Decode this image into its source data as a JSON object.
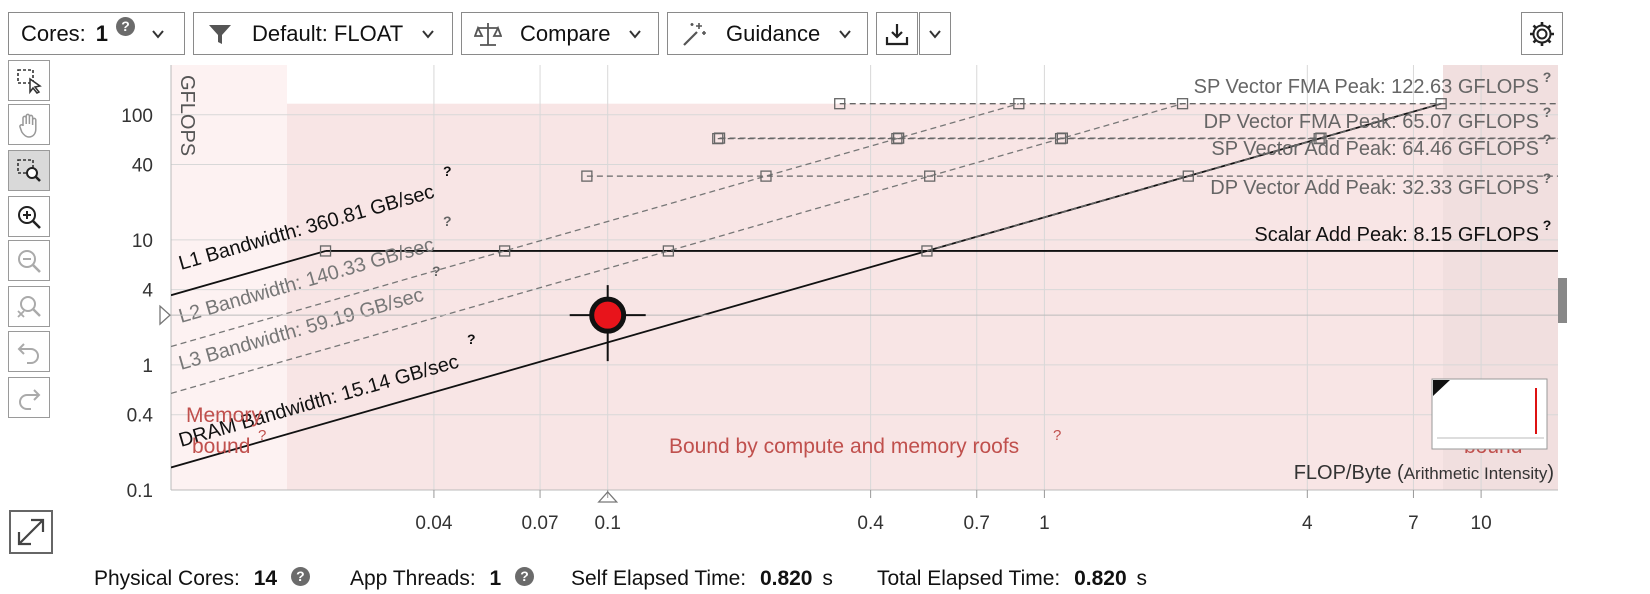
{
  "toolbar": {
    "cores_label": "Cores:",
    "cores_value": "1",
    "filter_label": "Default: FLOAT",
    "compare_label": "Compare",
    "guidance_label": "Guidance"
  },
  "status": {
    "physical_cores_label": "Physical Cores:",
    "physical_cores_value": "14",
    "app_threads_label": "App Threads:",
    "app_threads_value": "1",
    "self_elapsed_label": "Self Elapsed Time:",
    "self_elapsed_value": "0.820",
    "self_elapsed_unit": "s",
    "total_elapsed_label": "Total Elapsed Time:",
    "total_elapsed_value": "0.820",
    "total_elapsed_unit": "s"
  },
  "chart_data": {
    "type": "scatter",
    "subtype": "roofline",
    "ylabel": "GFLOPS",
    "xlabel": "FLOP/Byte",
    "xlabel_paren": "Arithmetic Intensity",
    "xscale": "log",
    "yscale": "log",
    "xlim": [
      0.01,
      15
    ],
    "ylim": [
      0.1,
      250
    ],
    "x_ticks": [
      0.04,
      0.07,
      0.1,
      0.4,
      0.7,
      1,
      4,
      7,
      10
    ],
    "x_tick_labels": [
      "0.04",
      "0.07",
      "0.1",
      "0.4",
      "0.7",
      "1",
      "4",
      "7",
      "10"
    ],
    "y_ticks": [
      0.1,
      0.4,
      1,
      4,
      10,
      40,
      100
    ],
    "y_tick_labels": [
      "0.1",
      "0.4",
      "1",
      "4",
      "10",
      "40",
      "100"
    ],
    "grid": true,
    "compute_roofs": [
      {
        "name": "SP Vector FMA Peak: 122.63 GFLOPS",
        "value": 122.63,
        "style": "dashed",
        "color": "#666666"
      },
      {
        "name": "DP Vector FMA Peak: 65.07 GFLOPS",
        "value": 65.07,
        "style": "dashed",
        "color": "#666666"
      },
      {
        "name": "SP Vector Add Peak: 64.46 GFLOPS",
        "value": 64.46,
        "style": "dashed",
        "color": "#666666"
      },
      {
        "name": "DP Vector Add Peak: 32.33 GFLOPS",
        "value": 32.33,
        "style": "dashed",
        "color": "#666666"
      },
      {
        "name": "Scalar Add Peak: 8.15 GFLOPS",
        "value": 8.15,
        "style": "solid",
        "color": "#111111"
      }
    ],
    "memory_roofs": [
      {
        "name": "L1 Bandwidth: 360.81 GB/sec",
        "value": 360.81,
        "style": "solid",
        "color": "#111111"
      },
      {
        "name": "L2 Bandwidth: 140.33 GB/sec",
        "value": 140.33,
        "style": "dashed",
        "color": "#777777"
      },
      {
        "name": "L3 Bandwidth: 59.19 GB/sec",
        "value": 59.19,
        "style": "dashed",
        "color": "#777777"
      },
      {
        "name": "DRAM Bandwidth: 15.14 GB/sec",
        "value": 15.14,
        "style": "solid",
        "color": "#111111"
      }
    ],
    "points": [
      {
        "x": 0.1,
        "y": 2.5,
        "color": "#e8141b",
        "marker": "circle-crosshair"
      }
    ],
    "regions": {
      "memory_bound": "Memory bound",
      "compute_memory": "Bound by compute and memory roofs",
      "compute_bound": "bound"
    },
    "region_color": "#c0504d",
    "help_mark": "?"
  }
}
